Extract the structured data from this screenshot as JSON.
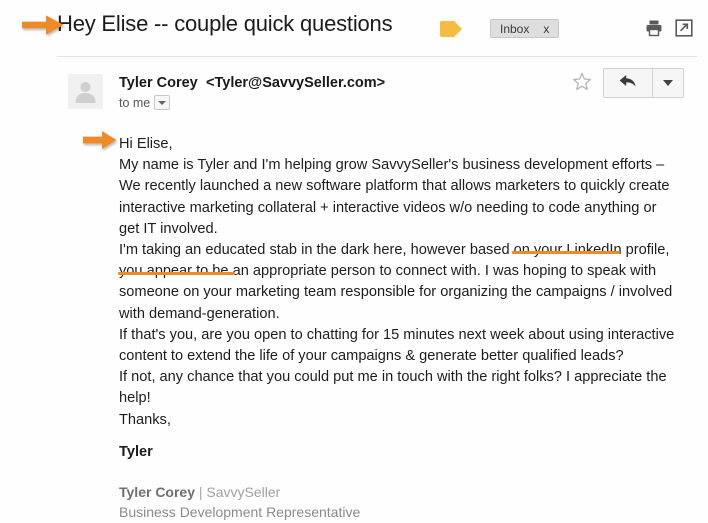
{
  "window": {
    "app": "email-client-message-view"
  },
  "header": {
    "subject": "Hey Elise -- couple quick questions",
    "label_tag_icon": "tag-icon",
    "inbox_chip": {
      "label": "Inbox",
      "close": "x"
    },
    "print_icon": "print-icon",
    "popout_icon": "open-in-new-window-icon"
  },
  "sender": {
    "avatar_icon": "person-avatar-icon",
    "name": "Tyler Corey",
    "email": "<Tyler@SavvySeller.com>",
    "recipient_line": "to me",
    "details_caret_icon": "chevron-down-icon",
    "star_icon": "star-outline-icon",
    "reply_icon": "reply-arrow-icon",
    "more_icon": "chevron-down-icon"
  },
  "message": {
    "greeting": "Hi Elise,",
    "paragraph_1_a": "My name is Tyler and I'm helping grow SavvySeller's business development efforts – We recently launched a new software platform that allows marketers to quickly create interactive marketing collateral + interactive videos w/o needing to code anything or get IT involved.",
    "paragraph_2_pre": "I'm taking an educated stab in the dark here, however ",
    "paragraph_2_hl1": "based on your",
    "paragraph_2_hl2": "LinkedIn profile,",
    "paragraph_2_post": " you appear to be an appropriate person to connect with. I was hoping to speak with someone on your marketing team responsible for organizing the campaigns / involved with demand-generation.",
    "paragraph_3": "If that's you, are you open to chatting for 15 minutes next week about using interactive content to extend the life of your campaigns & generate better qualified leads?",
    "paragraph_4": "If not, any chance that you could put me in touch with the right folks? I appreciate the help!",
    "closing": "Thanks,",
    "signoff_name": "Tyler",
    "signature": {
      "person": "Tyler Corey",
      "separator": " | ",
      "company": "SavvySeller",
      "role": "Business Development Representative"
    }
  },
  "annotations": {
    "arrow_subject": "orange-arrow-icon",
    "arrow_greeting": "orange-arrow-icon",
    "underline_1": "orange-underline",
    "underline_2": "orange-underline"
  },
  "colors": {
    "annotation_orange": "#ef8b26",
    "tag_yellow": "#f5bd3f",
    "chip_gray": "#dedede",
    "text_dark": "#1d1d1d",
    "signature_gray": "#8a8a8a"
  }
}
